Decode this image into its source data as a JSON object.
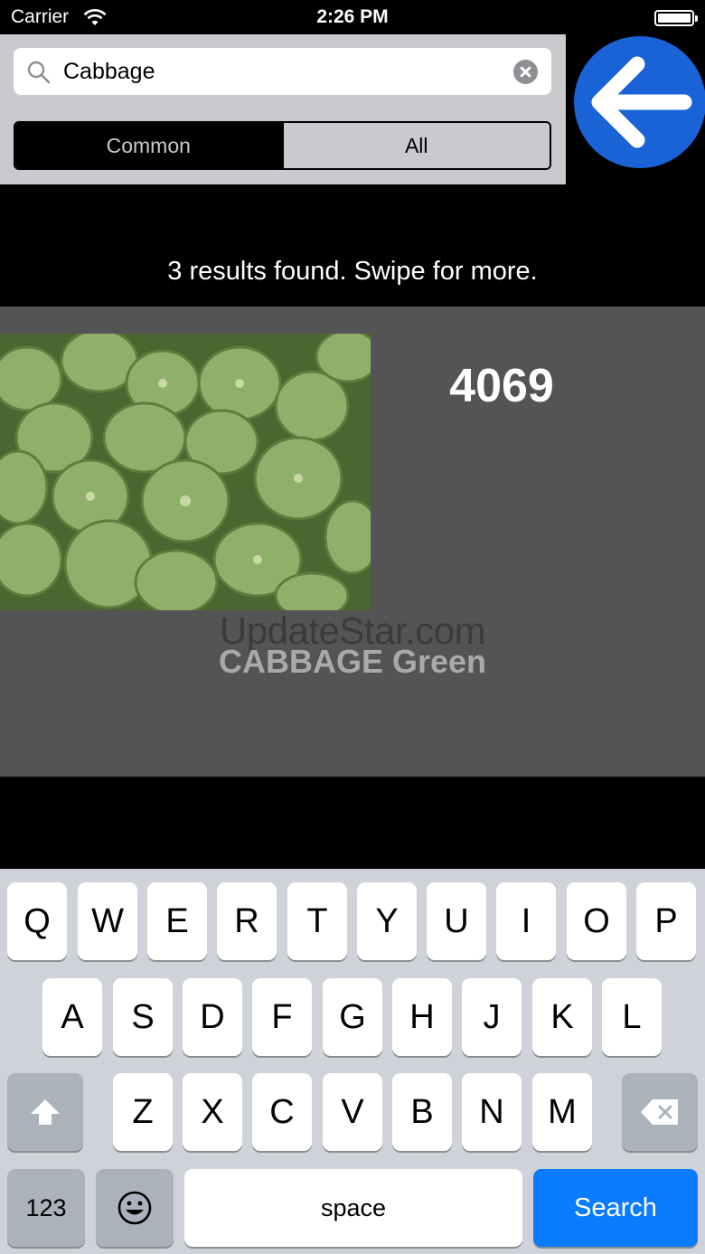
{
  "status_bar": {
    "carrier": "Carrier",
    "time": "2:26 PM"
  },
  "search": {
    "value": "Cabbage"
  },
  "segments": {
    "common": "Common",
    "all": "All"
  },
  "results": {
    "summary": "3 results found. Swipe for more."
  },
  "card": {
    "plu": "4069",
    "watermark": "UpdateStar.com",
    "name": "CABBAGE Green",
    "image_icon": "cabbage-photo"
  },
  "keyboard": {
    "row1": [
      "Q",
      "W",
      "E",
      "R",
      "T",
      "Y",
      "U",
      "I",
      "O",
      "P"
    ],
    "row2": [
      "A",
      "S",
      "D",
      "F",
      "G",
      "H",
      "J",
      "K",
      "L"
    ],
    "row3": [
      "Z",
      "X",
      "C",
      "V",
      "B",
      "N",
      "M"
    ],
    "numbers_label": "123",
    "space_label": "space",
    "search_label": "Search"
  },
  "colors": {
    "accent_blue": "#0a7cff",
    "back_button_blue": "#1a63d6",
    "card_bg": "#545454"
  }
}
